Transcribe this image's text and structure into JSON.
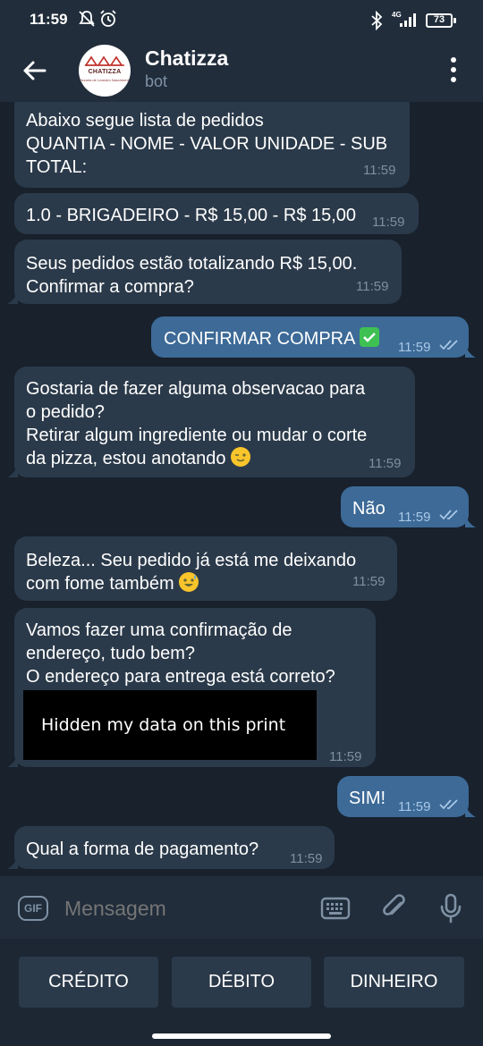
{
  "status_bar": {
    "time": "11:59",
    "network": "4G",
    "battery": "73"
  },
  "header": {
    "title": "Chatizza",
    "subtitle": "bot",
    "avatar_logo": "CHATIZZA",
    "avatar_tagline": "Pizzaria de Leandro Nascimento"
  },
  "messages": [
    {
      "dir": "in",
      "text": "Abaixo segue lista de pedidos\nQUANTIA - NOME - VALOR UNIDADE - SUB\nTOTAL:",
      "time": "11:59"
    },
    {
      "dir": "in",
      "text": "1.0 - BRIGADEIRO - R$ 15,00 - R$ 15,00",
      "time": "11:59"
    },
    {
      "dir": "in",
      "text": "Seus pedidos estão totalizando R$ 15,00.\nConfirmar a compra?",
      "time": "11:59"
    },
    {
      "dir": "out",
      "text": "CONFIRMAR COMPRA",
      "time": "11:59"
    },
    {
      "dir": "in",
      "text": "Gostaria de fazer alguma observacao para\no pedido?\nRetirar algum ingrediente ou mudar o corte\nda pizza, estou anotando",
      "time": "11:59"
    },
    {
      "dir": "out",
      "text": "Não",
      "time": "11:59"
    },
    {
      "dir": "in",
      "text": "Beleza... Seu pedido já está me deixando\ncom fome também",
      "time": "11:59"
    },
    {
      "dir": "in",
      "text": "Vamos fazer uma confirmação de\nendereço, tudo bem?\nO endereço para entrega está correto?",
      "time": "11:59",
      "hidden_note": "Hidden my data on this print"
    },
    {
      "dir": "out",
      "text": "SIM!",
      "time": "11:59"
    },
    {
      "dir": "in",
      "text": "Qual a forma de pagamento?",
      "time": "11:59"
    }
  ],
  "composer": {
    "gif_label": "GIF",
    "placeholder": "Mensagem"
  },
  "reply_keyboard": [
    "CRÉDITO",
    "DÉBITO",
    "DINHEIRO"
  ],
  "colors": {
    "bg": "#18212c",
    "header": "#212d3b",
    "bubble_in": "#2b3a4a",
    "bubble_out": "#3d6a97"
  }
}
